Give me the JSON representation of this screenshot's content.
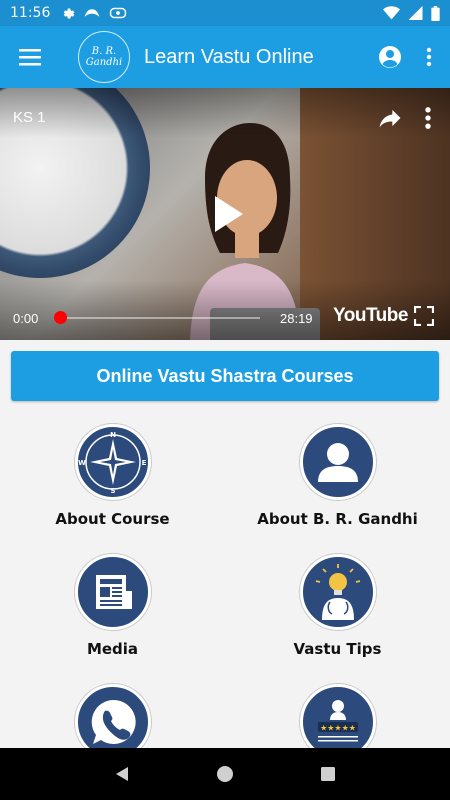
{
  "status_bar": {
    "time": "11:56"
  },
  "app_bar": {
    "logo_text": "B. R. Gandhi",
    "title": "Learn Vastu Online"
  },
  "video": {
    "title": "KS 1",
    "current_time": "0:00",
    "duration": "28:19",
    "progress": 0,
    "brand": "YouTube"
  },
  "cta": {
    "label": "Online Vastu Shastra Courses"
  },
  "tiles": [
    {
      "label": "About Course",
      "icon": "compass-icon"
    },
    {
      "label": "About B. R. Gandhi",
      "icon": "person-icon"
    },
    {
      "label": "Media",
      "icon": "newspaper-icon"
    },
    {
      "label": "Vastu Tips",
      "icon": "idea-bulb-icon"
    },
    {
      "label": "",
      "icon": "phone-icon"
    },
    {
      "label": "",
      "icon": "rating-icon"
    }
  ],
  "colors": {
    "app_bar": "#1e9ee2",
    "status_bar": "#1b8fd0",
    "tile_circle": "#2c4a7c",
    "seek_dot": "#ff0000"
  }
}
